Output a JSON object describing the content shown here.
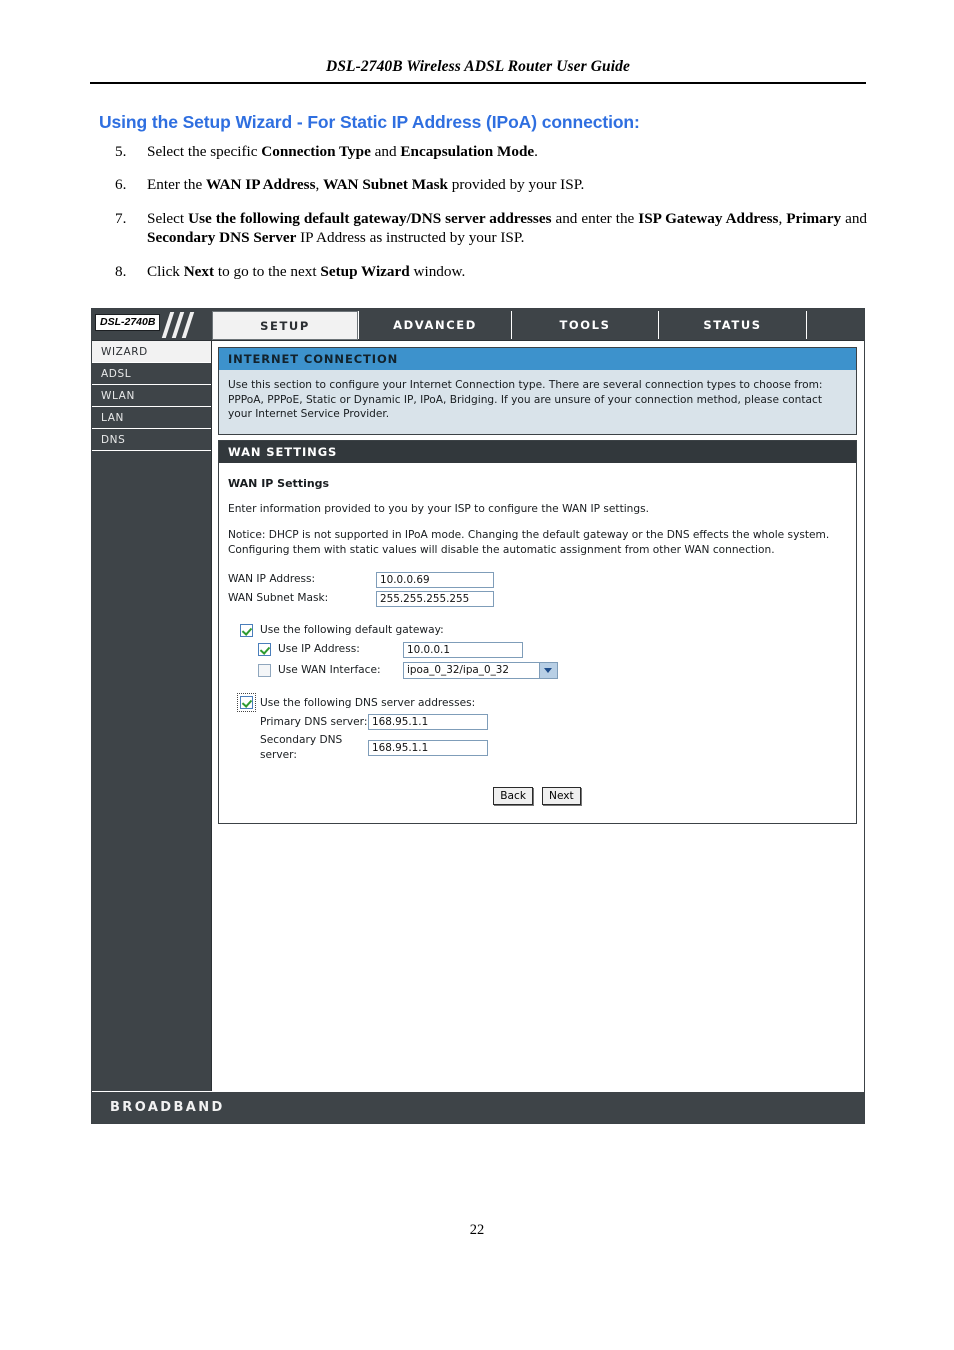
{
  "document": {
    "running_header": "DSL-2740B Wireless ADSL Router User Guide",
    "page_number": "22",
    "section_heading": "Using the Setup Wizard - For Static IP Address (IPoA) connection:",
    "heading_color": "#2f6fe0",
    "steps": [
      {
        "number": "5.",
        "html": "Select the specific <b>Connection Type</b> and <b>Encapsulation Mode</b>."
      },
      {
        "number": "6.",
        "html": "Enter the <b>WAN IP Address</b>, <b>WAN Subnet Mask</b> provided by your ISP."
      },
      {
        "number": "7.",
        "html": "Select <b>Use the following default gateway/DNS server addresses</b> and enter the <b>ISP Gateway Address</b>, <b>Primary</b> and <b>Secondary DNS Server</b> IP Address as instructed by your ISP."
      },
      {
        "number": "8.",
        "html": "Click <b>Next</b> to go to the next <b>Setup Wizard</b> window."
      }
    ]
  },
  "router_ui": {
    "brand": "DSL-2740B",
    "tabs": [
      {
        "label": "SETUP",
        "active": true
      },
      {
        "label": "ADVANCED",
        "active": false
      },
      {
        "label": "TOOLS",
        "active": false
      },
      {
        "label": "STATUS",
        "active": false
      }
    ],
    "sidebar": {
      "items": [
        {
          "label": "WIZARD",
          "active": true
        },
        {
          "label": "ADSL",
          "active": false
        },
        {
          "label": "WLAN",
          "active": false
        },
        {
          "label": "LAN",
          "active": false
        },
        {
          "label": "DNS",
          "active": false
        }
      ]
    },
    "internet_connection": {
      "title": "INTERNET CONNECTION",
      "description": "Use this section to configure your Internet Connection type. There are several connection types to choose from: PPPoA, PPPoE, Static or Dynamic IP, IPoA, Bridging. If you are unsure of your connection method, please contact your Internet Service Provider.",
      "header_color": "#3d92cc",
      "body_color": "#d9e3ea"
    },
    "wan_settings": {
      "title": "WAN SETTINGS",
      "subhead": "WAN IP Settings",
      "intro": "Enter information provided to you by your ISP to configure the WAN IP settings.",
      "notice": "Notice: DHCP is not supported in IPoA mode. Changing the default gateway or the DNS effects the whole system. Configuring them with static values will disable the automatic assignment from other WAN connection.",
      "fields": {
        "wan_ip_label": "WAN IP Address:",
        "wan_ip_value": "10.0.0.69",
        "wan_mask_label": "WAN Subnet Mask:",
        "wan_mask_value": "255.255.255.255"
      },
      "gateway": {
        "checkbox_label": "Use the following default gateway:",
        "checkbox_checked": true,
        "use_ip_label": "Use IP Address:",
        "use_ip_checked": true,
        "use_ip_value": "10.0.0.1",
        "use_wan_iface_label": "Use WAN Interface:",
        "use_wan_iface_checked": false,
        "use_wan_iface_value": "ipoa_0_32/ipa_0_32"
      },
      "dns": {
        "checkbox_label": "Use the following DNS server addresses:",
        "checkbox_checked": true,
        "checkbox_focused": true,
        "primary_label": "Primary DNS server:",
        "primary_value": "168.95.1.1",
        "secondary_label": "Secondary DNS server:",
        "secondary_value": "168.95.1.1"
      },
      "buttons": {
        "back": "Back",
        "next": "Next"
      }
    },
    "footer": {
      "text": "BROADBAND"
    }
  }
}
